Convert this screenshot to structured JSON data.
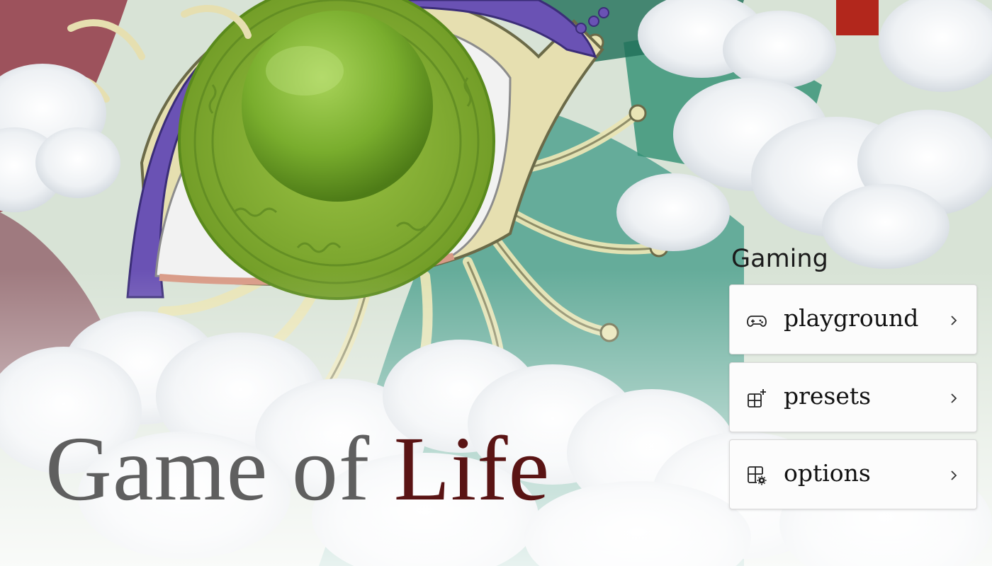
{
  "title": {
    "word1": "Game of",
    "word2": "Life"
  },
  "menu": {
    "section_label": "Gaming",
    "items": [
      {
        "label": "playground",
        "icon": "gamepad-icon"
      },
      {
        "label": "presets",
        "icon": "grid-add-icon"
      },
      {
        "label": "options",
        "icon": "settings-grid-icon"
      }
    ]
  },
  "colors": {
    "title_primary": "#5f5f5f",
    "title_accent": "#5a1414",
    "iris": "#7aa32a",
    "pupil": "#8dbd3a",
    "frame_purple": "#6a52b4",
    "card_bg": "#fcfcfc"
  }
}
